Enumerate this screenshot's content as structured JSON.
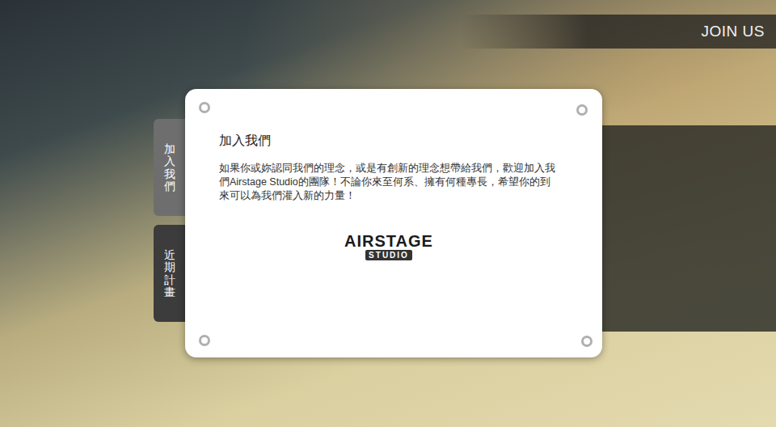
{
  "header": {
    "label": "JOIN US"
  },
  "tabs": [
    {
      "label": "加入我們",
      "selected": true
    },
    {
      "label": "近期計畫",
      "selected": false
    }
  ],
  "card": {
    "title": "加入我們",
    "body": "如果你或妳認同我們的理念，或是有創新的理念想帶給我們，歡迎加入我們Airstage Studio的團隊！不論你來至何系、擁有何種專長，希望你的到來可以為我們灌入新的力量！",
    "logo": {
      "name": "AIRSTAGE",
      "sub": "STUDIO"
    }
  }
}
